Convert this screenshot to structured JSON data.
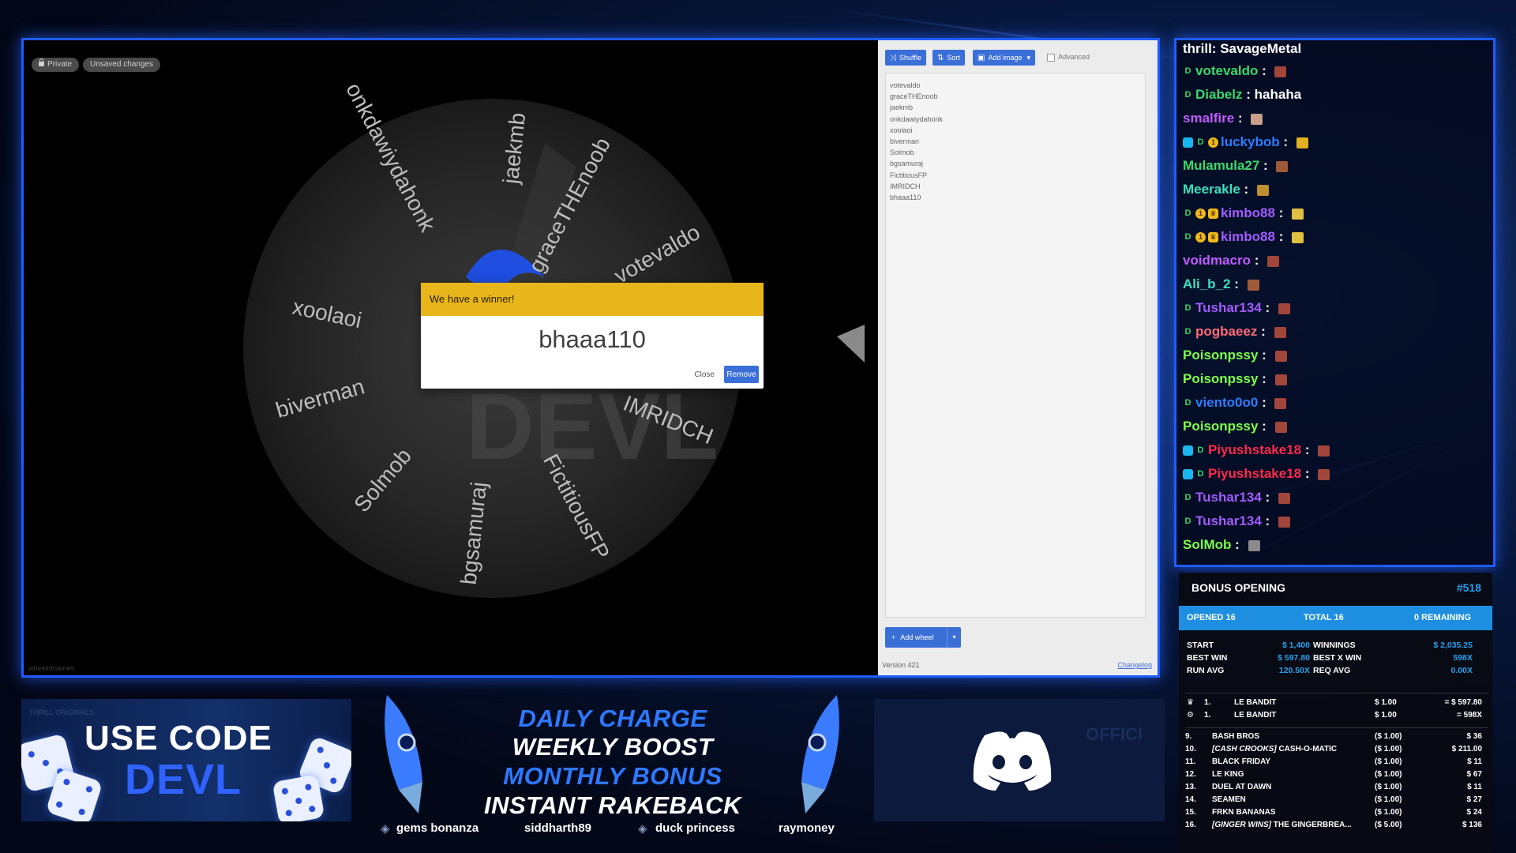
{
  "wheel": {
    "pill_private": "Private",
    "pill_unsaved": "Unsaved changes",
    "credit": "wheelofnames",
    "entries": [
      "votevaldo",
      "graceTHEnoob",
      "jaekmb",
      "onkdawiydahonk",
      "xoolaoi",
      "biverman",
      "Solmob",
      "bgsamuraj",
      "FictitiousFP",
      "IMRIDCH",
      "bhaaa110"
    ],
    "slice_labels": [
      "votevaldo",
      "graceTHEnoob",
      "jaekmb",
      "onkdawiydahonk",
      "xoolaoi",
      "biverman",
      "Solmob",
      "bgsamuraj",
      "FictitiousFP",
      "IMRIDCH",
      "aaa110"
    ]
  },
  "dialog": {
    "header": "We have a winner!",
    "winner": "bhaaa110",
    "close_label": "Close",
    "remove_label": "Remove"
  },
  "panel": {
    "shuffle_label": "Shuffle",
    "sort_label": "Sort",
    "add_image_label": "Add image",
    "advanced_label": "Advanced",
    "add_wheel_label": "Add wheel",
    "version": "Version 421",
    "changelog": "Changelog"
  },
  "chat": {
    "top_line": "thrill: SavageMetal",
    "messages": [
      {
        "user": "votevaldo",
        "color": "#3ad86a",
        "badges": [
          "d"
        ],
        "text": "",
        "emote": "#a0463a"
      },
      {
        "user": "Diabelz",
        "color": "#3ad86a",
        "badges": [
          "d"
        ],
        "text": "hahaha",
        "emote": ""
      },
      {
        "user": "smalfire",
        "color": "#c15bff",
        "badges": [],
        "text": "",
        "emote": "#c8a08a"
      },
      {
        "user": "luckybob",
        "color": "#2d7dff",
        "badges": [
          "gem",
          "d",
          "coin"
        ],
        "text": "",
        "emote": "#e0b020"
      },
      {
        "user": "Mulamula27",
        "color": "#3ad86a",
        "badges": [],
        "text": "",
        "emote": "#a05a3a"
      },
      {
        "user": "Meerakle",
        "color": "#3de0c0",
        "badges": [],
        "text": "",
        "emote": "#c09030"
      },
      {
        "user": "kimbo88",
        "color": "#a25bff",
        "badges": [
          "d",
          "coin",
          "crown"
        ],
        "text": "",
        "emote": "#e0c040"
      },
      {
        "user": "kimbo88",
        "color": "#a25bff",
        "badges": [
          "d",
          "coin",
          "crown"
        ],
        "text": "",
        "emote": "#e0c040"
      },
      {
        "user": "voidmacro",
        "color": "#c15bff",
        "badges": [],
        "text": "",
        "emote": "#a0463a"
      },
      {
        "user": "Ali_b_2",
        "color": "#3de0c0",
        "badges": [],
        "text": "",
        "emote": "#a05a3a"
      },
      {
        "user": "Tushar134",
        "color": "#a25bff",
        "badges": [
          "d"
        ],
        "text": "",
        "emote": "#a0463a"
      },
      {
        "user": "pogbaeez",
        "color": "#ff6b7a",
        "badges": [
          "d"
        ],
        "text": "",
        "emote": "#a0463a"
      },
      {
        "user": "Poisonpssy",
        "color": "#7dff4a",
        "badges": [],
        "text": "",
        "emote": "#a0463a"
      },
      {
        "user": "Poisonpssy",
        "color": "#7dff4a",
        "badges": [],
        "text": "",
        "emote": "#a0463a"
      },
      {
        "user": "viento0o0",
        "color": "#2d7dff",
        "badges": [
          "d"
        ],
        "text": "",
        "emote": "#a0463a"
      },
      {
        "user": "Poisonpssy",
        "color": "#7dff4a",
        "badges": [],
        "text": "",
        "emote": "#a0463a"
      },
      {
        "user": "Piyushstake18",
        "color": "#ff2a4a",
        "badges": [
          "gem",
          "d"
        ],
        "text": "",
        "emote": "#a0463a"
      },
      {
        "user": "Piyushstake18",
        "color": "#ff2a4a",
        "badges": [
          "gem",
          "d"
        ],
        "text": "",
        "emote": "#a0463a"
      },
      {
        "user": "Tushar134",
        "color": "#a25bff",
        "badges": [
          "d"
        ],
        "text": "",
        "emote": "#a0463a"
      },
      {
        "user": "Tushar134",
        "color": "#a25bff",
        "badges": [
          "d"
        ],
        "text": "",
        "emote": "#a0463a"
      },
      {
        "user": "SolMob",
        "color": "#7dff4a",
        "badges": [],
        "text": "",
        "emote": "#8a8a8a"
      }
    ]
  },
  "bonus": {
    "title": "BONUS OPENING",
    "number": "#518",
    "opened": "OPENED 16",
    "total": "TOTAL 16",
    "remaining": "0 REMAINING",
    "stats": [
      {
        "k1": "START",
        "v1": "$ 1,400",
        "k2": "WINNINGS",
        "v2": "$ 2,035.25"
      },
      {
        "k1": "BEST WIN",
        "v1": "$ 597.80",
        "k2": "BEST X WIN",
        "v2": "598X"
      },
      {
        "k1": "RUN AVG",
        "v1": "120.50X",
        "k2": "REQ AVG",
        "v2": "0.00X"
      }
    ],
    "bests": [
      {
        "icon": "♛",
        "rank": "1.",
        "name": "LE BANDIT",
        "bet": "$ 1.00",
        "result": "= $ 597.80"
      },
      {
        "icon": "⚙",
        "rank": "1.",
        "name": "LE BANDIT",
        "bet": "$ 1.00",
        "result": "= 598X"
      }
    ],
    "list": [
      {
        "rank": "9.",
        "tag": "",
        "name": "BASH BROS",
        "bet": "($ 1.00)",
        "win": "$ 36"
      },
      {
        "rank": "10.",
        "tag": "[CASH CROOKS]",
        "name": "CASH-O-MATIC",
        "bet": "($ 1.00)",
        "win": "$ 211.00"
      },
      {
        "rank": "11.",
        "tag": "",
        "name": "BLACK FRIDAY",
        "bet": "($ 1.00)",
        "win": "$ 11"
      },
      {
        "rank": "12.",
        "tag": "",
        "name": "LE KING",
        "bet": "($ 1.00)",
        "win": "$ 67"
      },
      {
        "rank": "13.",
        "tag": "",
        "name": "DUEL AT DAWN",
        "bet": "($ 1.00)",
        "win": "$ 11"
      },
      {
        "rank": "14.",
        "tag": "",
        "name": "SEAMEN",
        "bet": "($ 1.00)",
        "win": "$ 27"
      },
      {
        "rank": "15.",
        "tag": "",
        "name": "FRKN BANANAS",
        "bet": "($ 1.00)",
        "win": "$ 24"
      },
      {
        "rank": "16.",
        "tag": "[GINGER WINS]",
        "name": "THE GINGERBREA...",
        "bet": "($ 5.00)",
        "win": "$ 136"
      }
    ]
  },
  "promo": {
    "hint": "THRILL ORIGINALS",
    "line1": "USE CODE",
    "code": "DEVL"
  },
  "rakeback": {
    "lines": [
      "DAILY CHARGE",
      "WEEKLY BOOST",
      "MONTHLY BONUS",
      "INSTANT RAKEBACK"
    ],
    "sponsors": [
      "gems bonanza",
      "siddharth89",
      "duck princess",
      "raymoney"
    ]
  },
  "discord": {
    "watermark": "OFFICI"
  },
  "colors": {
    "frame_blue": "#1f5cff",
    "dialog_yellow": "#e8b51a",
    "button_blue": "#3b6fd8",
    "bonus_blue": "#1e8fe0"
  }
}
